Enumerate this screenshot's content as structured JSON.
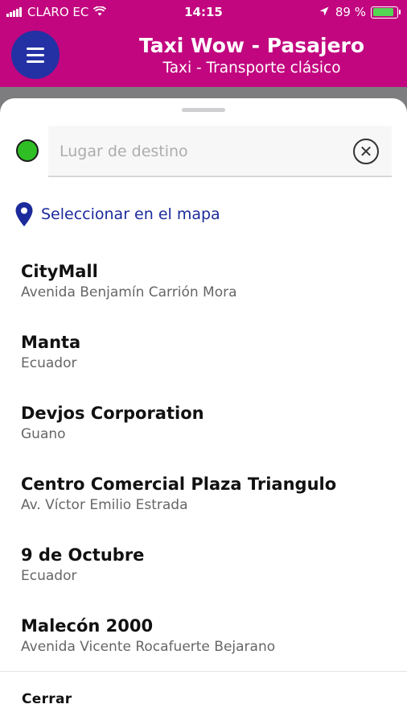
{
  "status_bar": {
    "carrier": "CLARO EC",
    "time": "14:15",
    "battery_percent": "89 %",
    "battery_level": 0.89
  },
  "header": {
    "title": "Taxi Wow - Pasajero",
    "subtitle": "Taxi - Transporte clásico"
  },
  "search": {
    "placeholder": "Lugar de destino",
    "value": ""
  },
  "map_select": {
    "label": "Seleccionar en el mapa"
  },
  "places": [
    {
      "name": "CityMall",
      "address": "Avenida Benjamín Carrión Mora"
    },
    {
      "name": "Manta",
      "address": "Ecuador"
    },
    {
      "name": "Devjos Corporation",
      "address": "Guano"
    },
    {
      "name": "Centro Comercial Plaza Triangulo",
      "address": "Av. Víctor Emilio Estrada"
    },
    {
      "name": "9 de Octubre",
      "address": "Ecuador"
    },
    {
      "name": "Malecón 2000",
      "address": "Avenida Vicente Rocafuerte Bejarano"
    }
  ],
  "footer": {
    "close_label": "Cerrar"
  },
  "colors": {
    "header_bg": "#c2067f",
    "menu_button_bg": "#2331a4",
    "origin_dot": "#2fbf25",
    "link_blue": "#1c2a9c"
  }
}
